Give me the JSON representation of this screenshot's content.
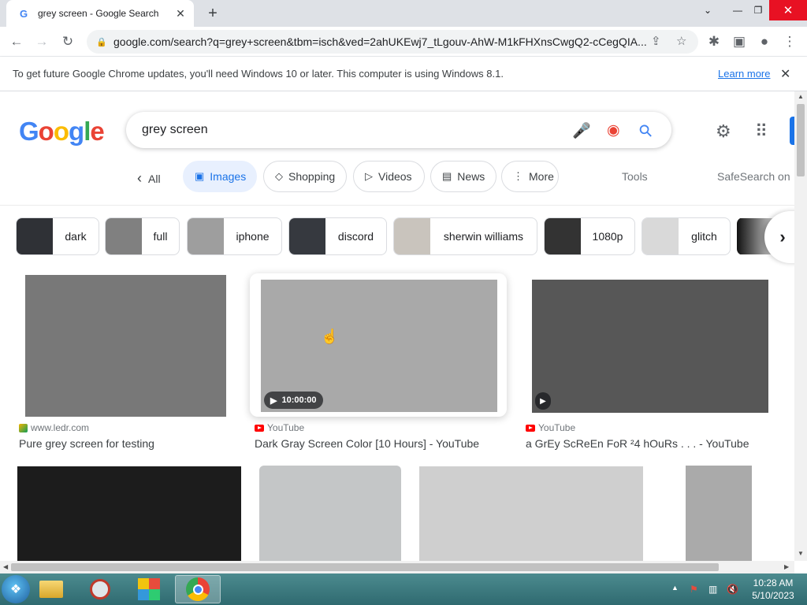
{
  "browser": {
    "tab_title": "grey screen - Google Search",
    "tab_favicon": "G",
    "url": "google.com/search?q=grey+screen&tbm=isch&ved=2ahUKEwj7_tLgouv-AhW-M1kFHXnsCwgQ2-cCegQIA...",
    "icons": {
      "close": "✕",
      "new_tab": "+",
      "minimize": "—",
      "restore": "❐",
      "dropdown": "⌄",
      "back": "←",
      "forward": "→",
      "reload": "↻",
      "lock": "🔒",
      "share": "⇪",
      "star": "☆",
      "extensions": "✱",
      "sidepanel": "▣",
      "profile": "●",
      "menu": "⋮"
    }
  },
  "infobar": {
    "message": "To get future Google Chrome updates, you'll need Windows 10 or later. This computer is using Windows 8.1.",
    "link": "Learn more",
    "close": "✕"
  },
  "google": {
    "logo_letters": [
      "G",
      "o",
      "o",
      "g",
      "l",
      "e"
    ],
    "logo_colors": [
      "#4285f4",
      "#ea4335",
      "#fbbc05",
      "#4285f4",
      "#34a853",
      "#ea4335"
    ],
    "query": "grey screen",
    "mic_icon": "🎤",
    "lens_icon": "◉",
    "search_icon": "⚲",
    "settings_icon": "⚙",
    "apps_icon": "⠿"
  },
  "filters": {
    "all": "All",
    "back_icon": "‹",
    "images": "Images",
    "shopping": "Shopping",
    "videos": "Videos",
    "news": "News",
    "more": "More",
    "tools": "Tools",
    "safesearch": "SafeSearch on",
    "icons": {
      "images": "▣",
      "shopping": "◇",
      "videos": "▷",
      "news": "▤",
      "more": "⋮"
    }
  },
  "suggestions": [
    {
      "label": "dark",
      "color": "#2f3136"
    },
    {
      "label": "full",
      "color": "#808080"
    },
    {
      "label": "iphone",
      "color": "#9e9e9e"
    },
    {
      "label": "discord",
      "color": "#36393f"
    },
    {
      "label": "sherwin williams",
      "color": "#c9c4bd"
    },
    {
      "label": "1080p",
      "color": "#333333"
    },
    {
      "label": "glitch",
      "color": "#d9d9d9"
    }
  ],
  "suggestions_next_icon": "›",
  "results": [
    {
      "source": "www.ledr.com",
      "title": "Pure grey screen for testing",
      "color": "#787878"
    },
    {
      "source": "YouTube",
      "title": "Dark Gray Screen Color [10 Hours] - YouTube",
      "duration": "10:00:00",
      "color": "#a9a9a9"
    },
    {
      "source": "YouTube",
      "title": "a GrEy ScReEn FoR ²4 hOuRs . . . - YouTube",
      "color": "#575757"
    }
  ],
  "results_row2_colors": [
    "#1c1c1c",
    "#c4c6c7",
    "#cfcfcf",
    "#aaaaaa"
  ],
  "play_icon": "▶",
  "taskbar": {
    "start_icon": "❖",
    "apps": [
      "File Explorer",
      "Snipping Tool",
      "Control Panel",
      "Google Chrome"
    ],
    "tray_icons": [
      "▲",
      "⚑",
      "▥",
      "🔇"
    ],
    "time": "10:28 AM",
    "date": "5/10/2023"
  }
}
